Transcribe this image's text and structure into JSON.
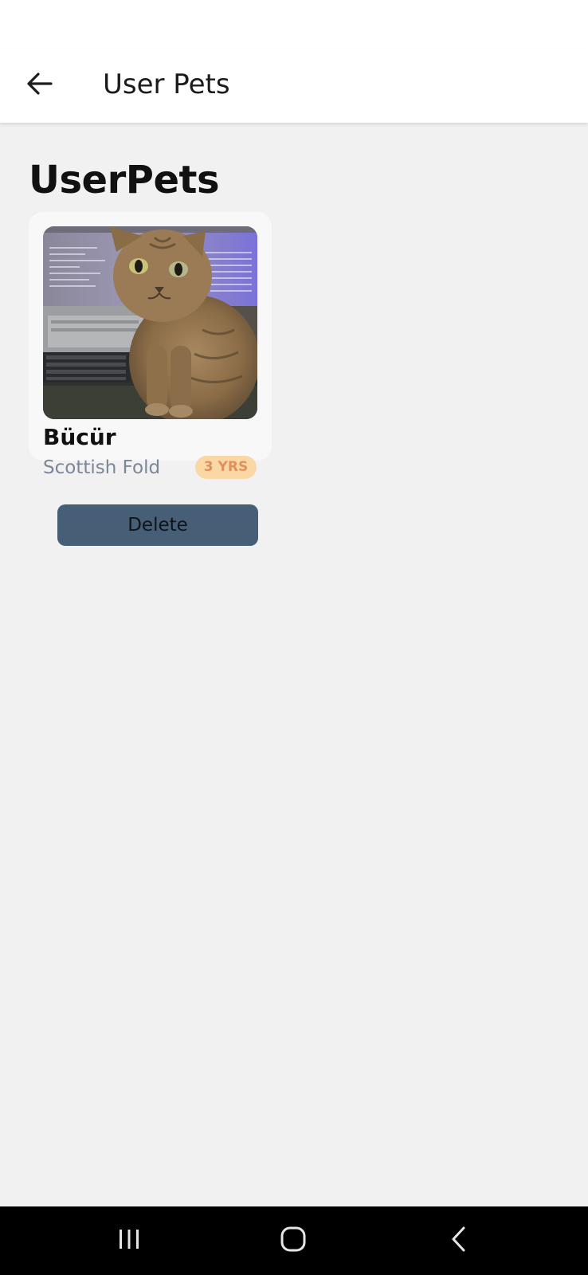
{
  "app_bar": {
    "title": "User Pets",
    "back_icon": "arrow-left-icon"
  },
  "page": {
    "heading": "UserPets"
  },
  "pets": [
    {
      "name": "Bücür",
      "breed": "Scottish Fold",
      "age_badge": "3 YRS",
      "photo": "cat-photo",
      "delete_label": "Delete"
    }
  ],
  "system_nav": {
    "recents_icon": "recents-icon",
    "home_icon": "home-icon",
    "back_icon": "chevron-left-icon"
  },
  "colors": {
    "app_bar_bg": "#ffffff",
    "page_bg": "#f1f1f1",
    "card_bg": "#f8f8f8",
    "badge_bg": "#f9d8a6",
    "badge_text": "#e0905c",
    "delete_button_bg": "#465e76",
    "breed_text": "#7b8797",
    "nav_bar_bg": "#000000"
  }
}
